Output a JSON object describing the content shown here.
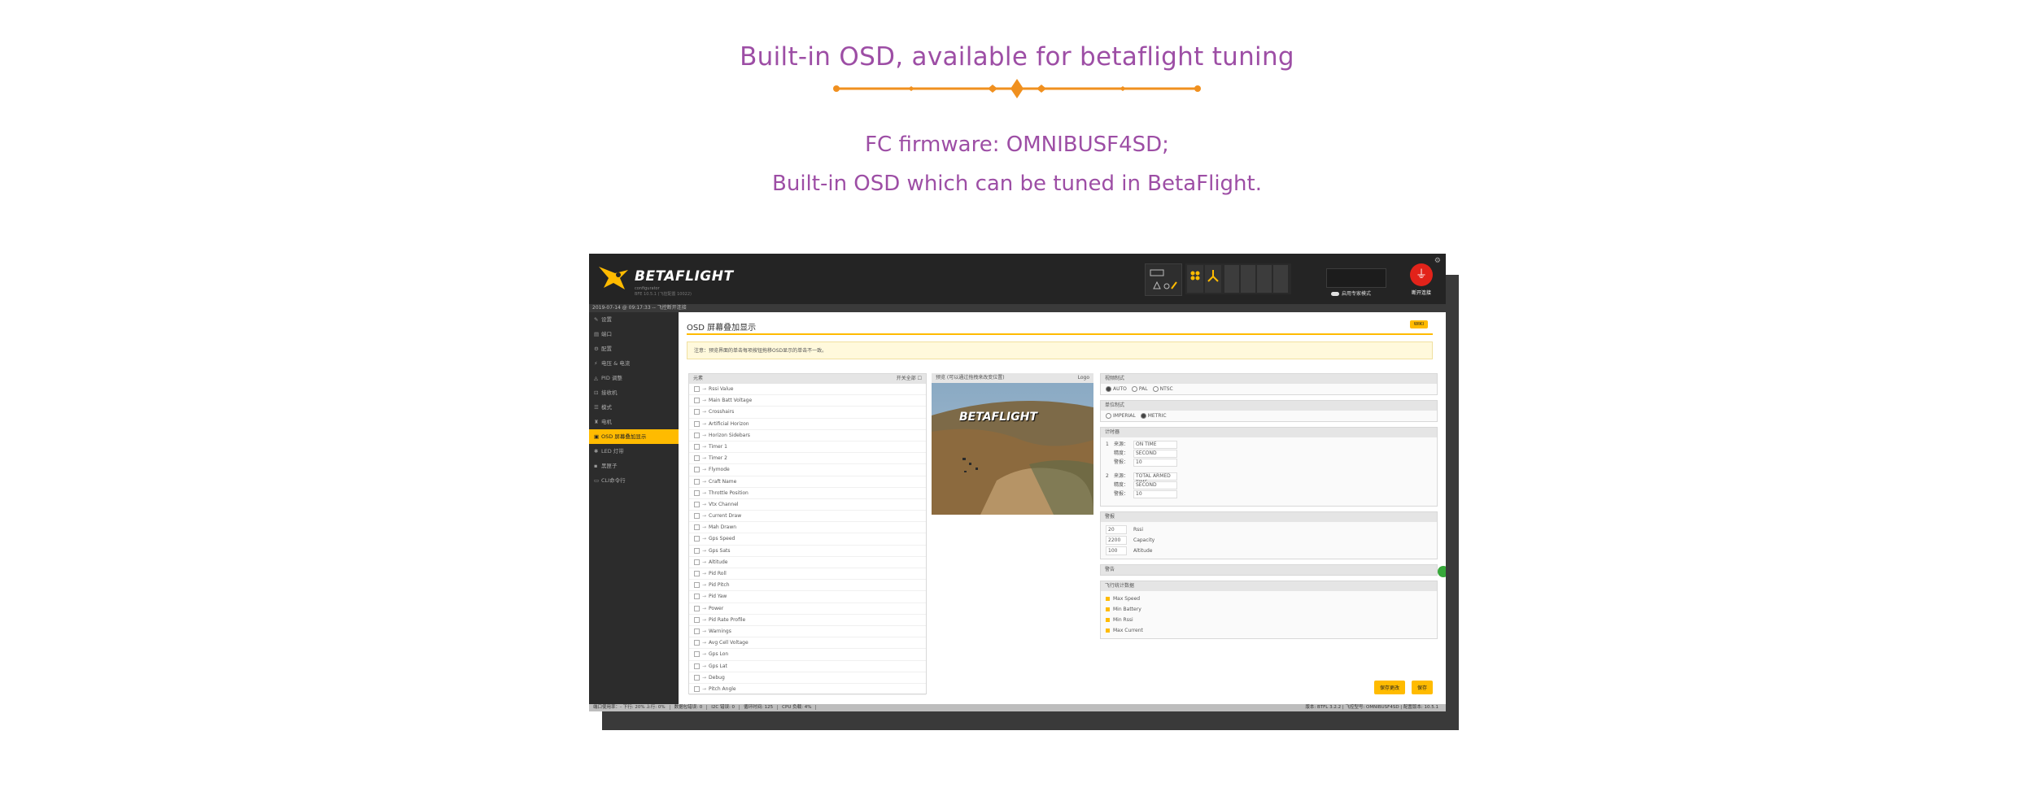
{
  "heading": {
    "title": "Built-in OSD,  available for betaflight tuning",
    "line1": "FC firmware: OMNIBUSF4SD;",
    "line2": "Built-in OSD which can be tuned in BetaFlight."
  },
  "app": {
    "logo_text": "BETAFLIGHT",
    "logo_sub": "configurator",
    "logo_version": "BFE 10.5.1 (飞控配置 10022)",
    "expert_mode": "启用专家模式",
    "usb_label": "断开连接",
    "log_line": "2019-07-14 @ 09:17:33 -- 飞控断开连接"
  },
  "sidebar": {
    "items": [
      {
        "icon": "wrench-icon",
        "glyph": "✎",
        "label": "设置"
      },
      {
        "icon": "ports-icon",
        "glyph": "▤",
        "label": "端口"
      },
      {
        "icon": "config-icon",
        "glyph": "⚙",
        "label": "配置"
      },
      {
        "icon": "power-icon",
        "glyph": "⚡",
        "label": "电压 & 电流"
      },
      {
        "icon": "pid-icon",
        "glyph": "◬",
        "label": "PID 调整"
      },
      {
        "icon": "receiver-icon",
        "glyph": "⊡",
        "label": "接收机"
      },
      {
        "icon": "modes-icon",
        "glyph": "☰",
        "label": "模式"
      },
      {
        "icon": "motors-icon",
        "glyph": "♜",
        "label": "电机"
      },
      {
        "icon": "osd-icon",
        "glyph": "▣",
        "label": "OSD 屏幕叠加显示",
        "active": true
      },
      {
        "icon": "led-icon",
        "glyph": "✱",
        "label": "LED 灯带"
      },
      {
        "icon": "blackbox-icon",
        "glyph": "▪",
        "label": "黑匣子"
      },
      {
        "icon": "cli-icon",
        "glyph": "▭",
        "label": "CLI命令行"
      }
    ]
  },
  "main": {
    "title": "OSD 屏幕叠加显示",
    "wiki_label": "WIKI",
    "notice": "注意：预览界面的单击每项按钮拖移OSD显示的单击不一致。",
    "elements_header": "元素",
    "elements_header_right": "开关全部 ☐",
    "elements": [
      "Rssi Value",
      "Main Batt Voltage",
      "Crosshairs",
      "Artificial Horizon",
      "Horizon Sidebars",
      "Timer 1",
      "Timer 2",
      "Flymode",
      "Craft Name",
      "Throttle Position",
      "Vtx Channel",
      "Current Draw",
      "Mah Drawn",
      "Gps Speed",
      "Gps Sats",
      "Altitude",
      "Pid Roll",
      "Pid Pitch",
      "Pid Yaw",
      "Power",
      "Pid Rate Profile",
      "Warnings",
      "Avg Cell Voltage",
      "Gps Lon",
      "Gps Lat",
      "Debug",
      "Pitch Angle"
    ],
    "preview_header": "预览 (可以通过拖拽来改变位置)",
    "preview_header_right": "Logo",
    "preview_logo": "BETAFLIGHT",
    "video_format": {
      "header": "视频制式",
      "options": [
        "AUTO",
        "PAL",
        "NTSC"
      ],
      "selected": "AUTO"
    },
    "units": {
      "header": "单位制式",
      "options": [
        "IMPERIAL",
        "METRIC"
      ],
      "selected": "METRIC"
    },
    "timers": {
      "header": "计时器",
      "items": [
        {
          "index": "1",
          "source_label": "来源：",
          "source": "ON TIME",
          "precision_label": "精度：",
          "precision": "SECOND",
          "alarm_label": "警报：",
          "alarm": "10"
        },
        {
          "index": "2",
          "source_label": "来源：",
          "source": "TOTAL ARMED TIME",
          "precision_label": "精度：",
          "precision": "SECOND",
          "alarm_label": "警报：",
          "alarm": "10"
        }
      ]
    },
    "alarms": {
      "header": "警报",
      "items": [
        {
          "value": "20",
          "label": "Rssi"
        },
        {
          "value": "2200",
          "label": "Capacity"
        },
        {
          "value": "100",
          "label": "Altitude"
        }
      ]
    },
    "warnings_header": "警告",
    "stats": {
      "header": "飞行统计数据",
      "items": [
        "Max Speed",
        "Min Battery",
        "Min Rssi",
        "Max Current"
      ]
    },
    "buttons": {
      "save_font": "保存更改",
      "save": "保存"
    }
  },
  "statusbar": {
    "items": [
      "端口使用率：- 下行: 20% 上行: 0%",
      "数据包错误: 0",
      "I2C 错误: 0",
      "循环时间: 125",
      "CPU 负载: 4%"
    ],
    "version": "版本: BTFL 3.2.2 | 飞控型号: OMNIBUSF4SD | 配置版本: 10.5.1"
  },
  "colors": {
    "accent": "#ffbb00",
    "heading": "#9d4ea5",
    "divider": "#f0901f"
  }
}
